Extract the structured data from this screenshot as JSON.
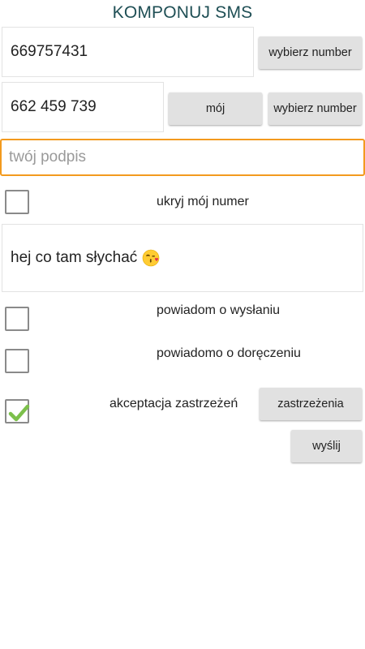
{
  "header": {
    "title": "KOMPONUJ SMS"
  },
  "recipient": {
    "phone_value": "669757431",
    "choose_label": "wybierz number"
  },
  "sender": {
    "phone_value": "662 459 739",
    "mine_label": "mój",
    "choose_label": "wybierz number"
  },
  "signature": {
    "placeholder": "twój podpis"
  },
  "hide_number": {
    "label": "ukryj mój numer",
    "checked": false
  },
  "message": {
    "text": "hej co tam słychać",
    "emoji_icon": "kissing-face-icon"
  },
  "notify_sent": {
    "label": "powiadom o wysłaniu",
    "checked": false
  },
  "notify_delivery": {
    "label": "powiadomo o doręczeniu",
    "checked": false
  },
  "terms": {
    "label": "akceptacja zastrzeżeń",
    "checked": true,
    "button_label": "zastrzeżenia"
  },
  "send": {
    "label": "wyślij"
  },
  "colors": {
    "accent_focus": "#f39a1e",
    "title": "#1f4f55",
    "check": "#7cc04b"
  }
}
